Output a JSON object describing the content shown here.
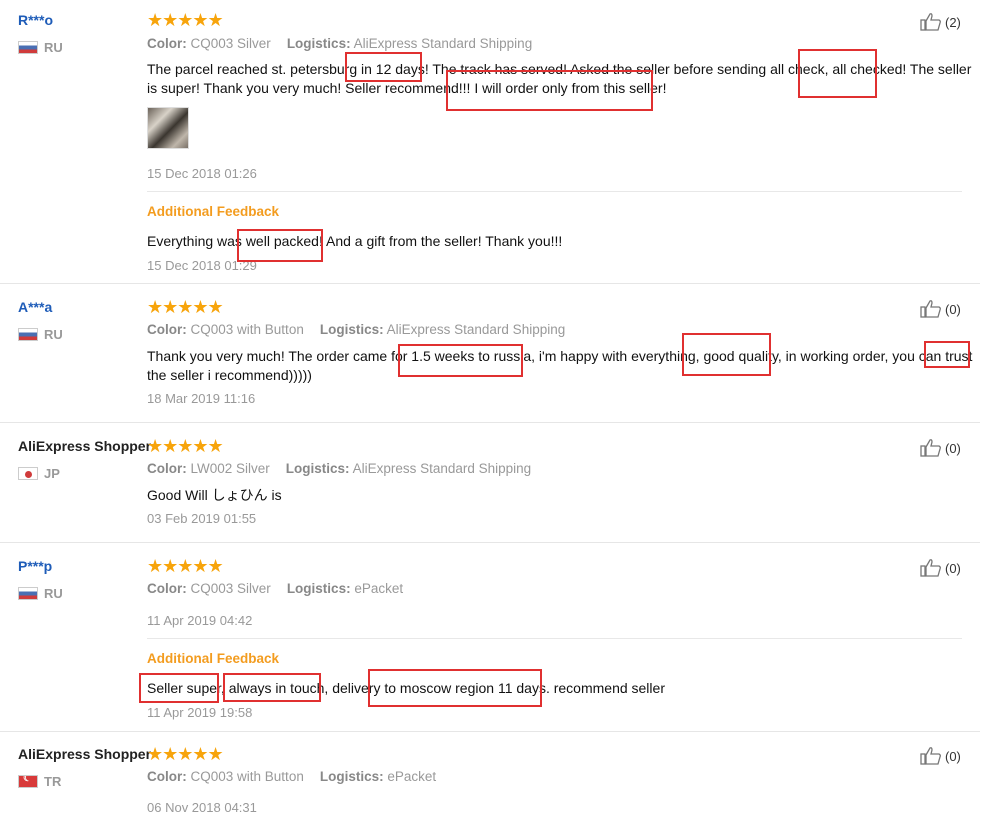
{
  "labels": {
    "color": "Color:",
    "logistics": "Logistics:",
    "additional_feedback": "Additional Feedback",
    "stars": "★★★★★"
  },
  "reviews": [
    {
      "user": "R***o",
      "country": "RU",
      "likes": "(2)",
      "color": "CQ003 Silver",
      "logistics": "AliExpress Standard Shipping",
      "text": "The parcel reached st. petersburg in 12 days! The track has served! Asked the seller before sending all check, all checked! The seller is super! Thank you very much! Seller recommend!!! I will order only from this seller!",
      "date": "15 Dec 2018 01:26",
      "additional_text": "Everything was well packed! And a gift from the seller! Thank you!!!",
      "additional_date": "15 Dec 2018 01:29"
    },
    {
      "user": "A***a",
      "country": "RU",
      "likes": "(0)",
      "color": "CQ003 with Button",
      "logistics": "AliExpress Standard Shipping",
      "text": "Thank you very much! The order came for 1.5 weeks to russia, i'm happy with everything, good quality, in working order, you can trust the seller i recommend)))))",
      "date": "18 Mar 2019 11:16"
    },
    {
      "user": "AliExpress Shopper",
      "country": "JP",
      "likes": "(0)",
      "color": "LW002 Silver",
      "logistics": "AliExpress Standard Shipping",
      "text": "Good Will しょひん is",
      "date": "03 Feb 2019 01:55"
    },
    {
      "user": "P***p",
      "country": "RU",
      "likes": "(0)",
      "color": "CQ003 Silver",
      "logistics": "ePacket",
      "date": "11 Apr 2019 04:42",
      "additional_text": "Seller super, always in touch, delivery to moscow region 11 days. recommend seller",
      "additional_date": "11 Apr 2019 19:58"
    },
    {
      "user": "AliExpress Shopper",
      "country": "TR",
      "likes": "(0)",
      "color": "CQ003 with Button",
      "logistics": "ePacket",
      "date": "06 Nov 2018 04:31"
    }
  ],
  "colors": {
    "star": "#f7a40b",
    "user_link": "#1e5cb8",
    "additional": "#f39c1f",
    "highlight": "#e03030"
  },
  "icons": {
    "like": "thumbs-up-icon"
  }
}
